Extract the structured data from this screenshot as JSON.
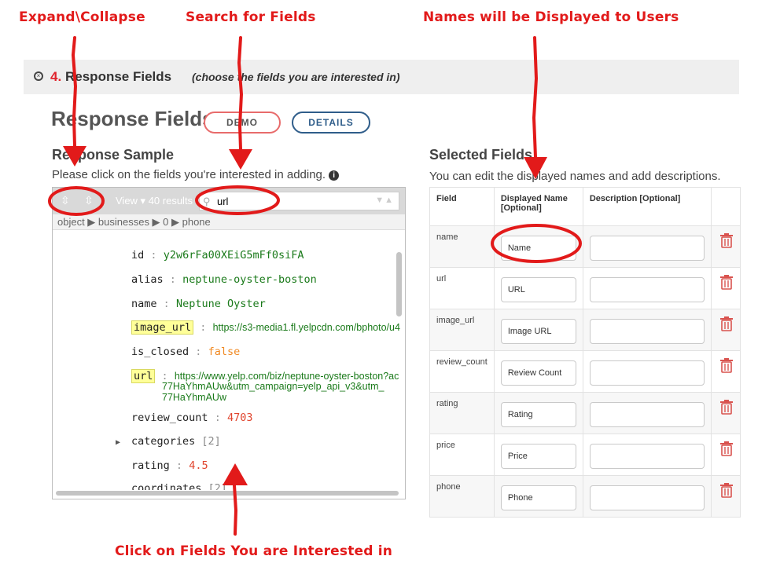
{
  "annotations": {
    "expand_collapse": "Expand\\Collapse",
    "search_fields": "Search for Fields",
    "names_displayed": "Names will be Displayed to Users",
    "click_fields": "Click on Fields You are Interested in"
  },
  "section": {
    "number": "4.",
    "title": "Response Fields",
    "subtitle": "(choose the fields you are interested in)"
  },
  "page_title": "Response Fields",
  "buttons": {
    "demo": "DEMO",
    "details": "DETAILS"
  },
  "sample": {
    "heading": "Response Sample",
    "hint": "Please click on the fields you're interested in adding.",
    "view_label": "View ▾ 40 results",
    "search_value": "url",
    "breadcrumb": "object ▶ businesses ▶ 0 ▶ phone",
    "rows": {
      "id_key": "id",
      "id_val": "y2w6rFa00XEiG5mFf0siFA",
      "alias_key": "alias",
      "alias_val": "neptune-oyster-boston",
      "name_key": "name",
      "name_val": "Neptune Oyster",
      "image_key": "image_url",
      "image_val": "https://s3-media1.fl.yelpcdn.com/bphoto/u4",
      "closed_key": "is_closed",
      "closed_val": "false",
      "url_key": "url",
      "url_val_1": "https://www.yelp.com/biz/neptune-oyster-boston?ac",
      "url_val_2": "77HaYhmAUw&utm_campaign=yelp_api_v3&utm_",
      "url_val_3": "77HaYhmAUw",
      "review_key": "review_count",
      "review_val": "4703",
      "categories_key": "categories",
      "categories_val": "[2]",
      "rating_key": "rating",
      "rating_val": "4.5",
      "coords_key": "coordinates",
      "coords_val": "[2]"
    }
  },
  "selected": {
    "heading": "Selected Fields",
    "hint": "You can edit the displayed names and add descriptions.",
    "columns": {
      "field": "Field",
      "display_1": "Displayed Name",
      "display_2": "[Optional]",
      "desc": "Description [Optional]"
    },
    "rows": [
      {
        "field": "name",
        "display": "Name"
      },
      {
        "field": "url",
        "display": "URL"
      },
      {
        "field": "image_url",
        "display": "Image URL"
      },
      {
        "field": "review_count",
        "display": "Review Count"
      },
      {
        "field": "rating",
        "display": "Rating"
      },
      {
        "field": "price",
        "display": "Price"
      },
      {
        "field": "phone",
        "display": "Phone"
      }
    ]
  },
  "colors": {
    "annotation_red": "#e21a1a",
    "accent_red": "#e0242d",
    "trash_red": "#d9534f",
    "details_blue": "#2f5d8a"
  }
}
